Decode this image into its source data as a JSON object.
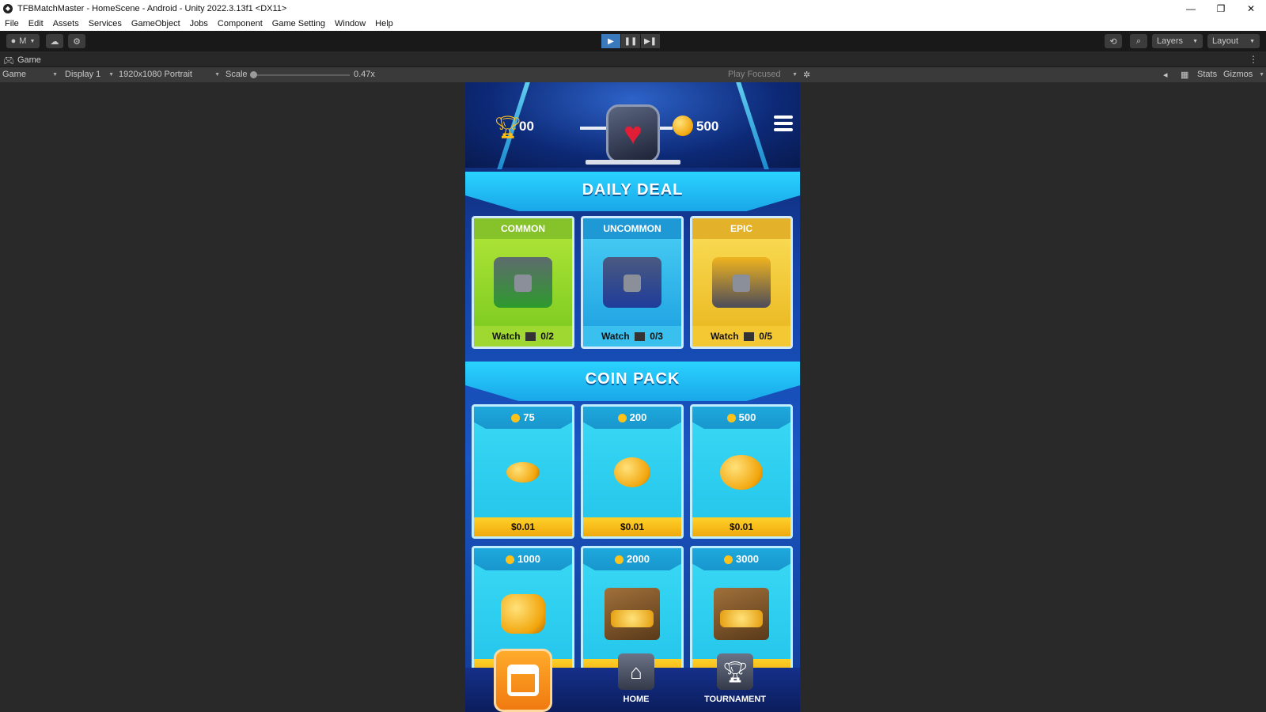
{
  "window": {
    "title": "TFBMatchMaster - HomeScene - Android - Unity 2022.3.13f1 <DX11>"
  },
  "menu": [
    "File",
    "Edit",
    "Assets",
    "Services",
    "GameObject",
    "Jobs",
    "Component",
    "Game Setting",
    "Window",
    "Help"
  ],
  "toolbar": {
    "account_label": "M",
    "layers_label": "Layers",
    "layout_label": "Layout"
  },
  "tab": {
    "game_label": "Game"
  },
  "gamebar": {
    "view_mode": "Game",
    "display": "Display 1",
    "resolution": "1920x1080 Portrait",
    "scale_label": "Scale",
    "scale_value": "0.47x",
    "play_mode": "Play Focused",
    "stats_label": "Stats",
    "gizmos_label": "Gizmos"
  },
  "hud": {
    "trophies": "00",
    "coins": "500"
  },
  "daily_deal": {
    "title": "DAILY DEAL",
    "cards": [
      {
        "rarity": "COMMON",
        "watch_label": "Watch",
        "progress": "0/2",
        "color": "#9ed62a"
      },
      {
        "rarity": "UNCOMMON",
        "watch_label": "Watch",
        "progress": "0/3",
        "color": "#2fb6ea"
      },
      {
        "rarity": "EPIC",
        "watch_label": "Watch",
        "progress": "0/5",
        "color": "#f1c52c"
      }
    ]
  },
  "coin_pack": {
    "title": "COIN PACK",
    "packs": [
      {
        "amount": "75",
        "price": "$0.01"
      },
      {
        "amount": "200",
        "price": "$0.01"
      },
      {
        "amount": "500",
        "price": "$0.01"
      },
      {
        "amount": "1000",
        "price": ""
      },
      {
        "amount": "2000",
        "price": ""
      },
      {
        "amount": "3000",
        "price": ""
      }
    ]
  },
  "nav": {
    "home_label": "HOME",
    "tournament_label": "TOURNAMENT"
  },
  "colors": {
    "accent": "#3a79bb",
    "editor_bg": "#282828",
    "banner": "#2ad3ff"
  }
}
